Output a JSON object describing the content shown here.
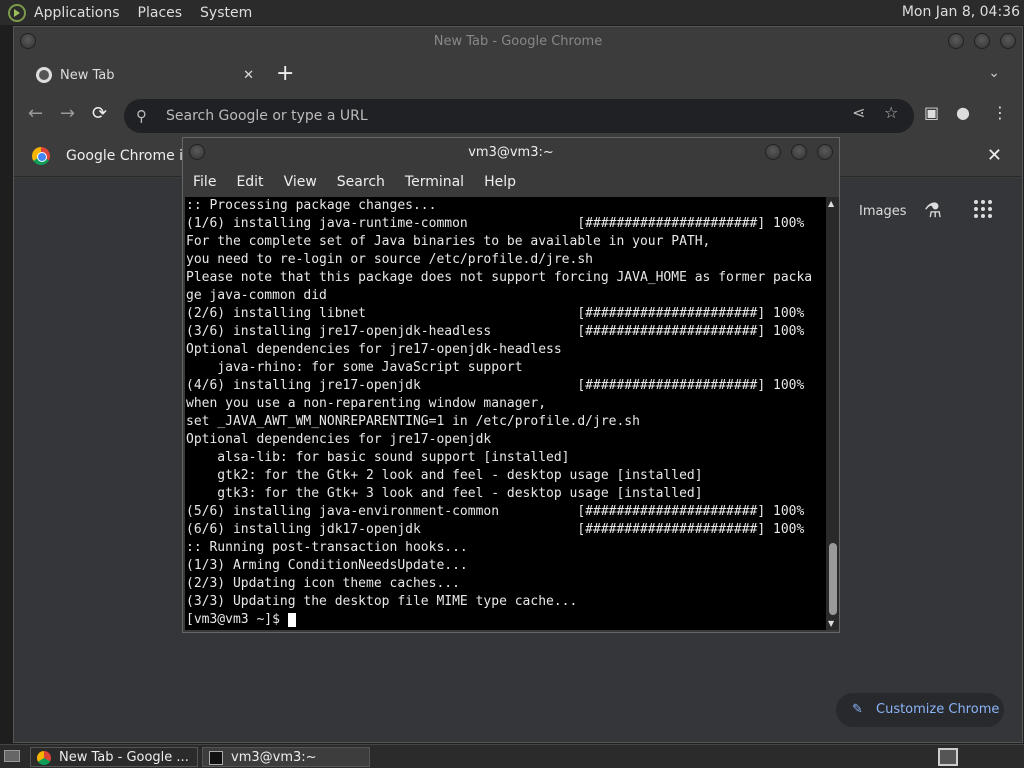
{
  "panel": {
    "menus": [
      "Applications",
      "Places",
      "System"
    ],
    "clock": "Mon Jan  8, 04:36"
  },
  "chrome": {
    "window_title": "New Tab - Google Chrome",
    "tab_title": "New Tab",
    "tab_close": "✕",
    "new_tab": "+",
    "tab_search": "⌄",
    "omnibox_placeholder": "Search Google or type a URL",
    "infobar_message": "Google Chrome isn",
    "infobar_close": "✕",
    "images_link": "Images",
    "customize_label": "Customize Chrome"
  },
  "terminal": {
    "title": "vm3@vm3:~",
    "menu": [
      "File",
      "Edit",
      "View",
      "Search",
      "Terminal",
      "Help"
    ],
    "lines": [
      ":: Processing package changes...",
      "(1/6) installing java-runtime-common              [######################] 100%",
      "For the complete set of Java binaries to be available in your PATH,",
      "you need to re-login or source /etc/profile.d/jre.sh",
      "Please note that this package does not support forcing JAVA_HOME as former packa",
      "ge java-common did",
      "(2/6) installing libnet                           [######################] 100%",
      "(3/6) installing jre17-openjdk-headless           [######################] 100%",
      "Optional dependencies for jre17-openjdk-headless",
      "    java-rhino: for some JavaScript support",
      "(4/6) installing jre17-openjdk                    [######################] 100%",
      "when you use a non-reparenting window manager,",
      "set _JAVA_AWT_WM_NONREPARENTING=1 in /etc/profile.d/jre.sh",
      "Optional dependencies for jre17-openjdk",
      "    alsa-lib: for basic sound support [installed]",
      "    gtk2: for the Gtk+ 2 look and feel - desktop usage [installed]",
      "    gtk3: for the Gtk+ 3 look and feel - desktop usage [installed]",
      "(5/6) installing java-environment-common          [######################] 100%",
      "(6/6) installing jdk17-openjdk                    [######################] 100%",
      ":: Running post-transaction hooks...",
      "(1/3) Arming ConditionNeedsUpdate...",
      "(2/3) Updating icon theme caches...",
      "(3/3) Updating the desktop file MIME type cache..."
    ],
    "prompt": "[vm3@vm3 ~]$ "
  },
  "taskbar": {
    "tasks": [
      "New Tab - Google ...",
      "vm3@vm3:~"
    ]
  }
}
